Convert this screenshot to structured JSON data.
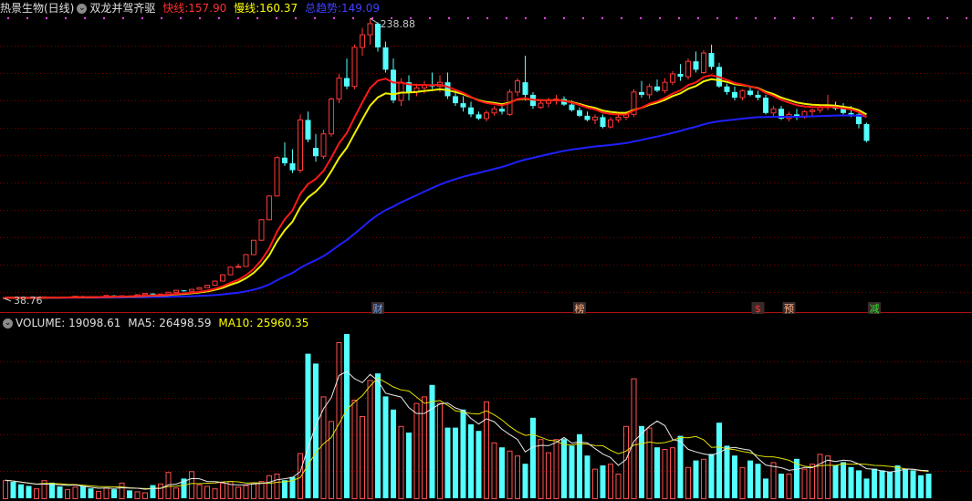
{
  "price_header": {
    "stock_name": "热景生物(日线)",
    "indicator_name": "双龙并驾齐驱",
    "fast_label": "快线:",
    "fast_value": "157.90",
    "fast_color": "#ff3030",
    "slow_label": "慢线:",
    "slow_value": "160.37",
    "slow_color": "#ffff00",
    "trend_label": "总趋势:",
    "trend_value": "149.09",
    "trend_color": "#3030ff"
  },
  "vol_header": {
    "vol_label": "VOLUME:",
    "vol_value": "19098.61",
    "ma5_label": "MA5:",
    "ma5_value": "26498.59",
    "ma10_label": "MA10:",
    "ma10_value": "25960.35"
  },
  "annotations": {
    "high_value": "238.88",
    "low_value": "38.76",
    "events": [
      {
        "text": "财",
        "color": "#6fa8ff"
      },
      {
        "text": "榜",
        "color": "#ffb080"
      },
      {
        "text": "$",
        "color": "#ff3030"
      },
      {
        "text": "预",
        "color": "#ffb080"
      },
      {
        "text": "减",
        "color": "#30e030"
      }
    ]
  },
  "chart_data": [
    {
      "type": "candlestick",
      "title": "热景生物(日线)",
      "series_names": [
        "快线",
        "慢线",
        "总趋势"
      ],
      "candles": [
        [
          38.5,
          39.2,
          38.0,
          38.6
        ],
        [
          38.6,
          38.9,
          38.3,
          38.5
        ],
        [
          38.5,
          38.8,
          38.1,
          38.4
        ],
        [
          38.4,
          38.7,
          38.0,
          38.3
        ],
        [
          38.3,
          39.0,
          38.1,
          38.8
        ],
        [
          38.8,
          39.5,
          38.6,
          39.2
        ],
        [
          39.2,
          39.3,
          38.7,
          38.9
        ],
        [
          38.9,
          39.1,
          38.5,
          38.7
        ],
        [
          38.7,
          39.4,
          38.6,
          39.1
        ],
        [
          39.1,
          39.8,
          38.9,
          39.6
        ],
        [
          39.6,
          39.9,
          39.2,
          39.4
        ],
        [
          39.4,
          39.6,
          38.9,
          39.0
        ],
        [
          39.0,
          39.5,
          38.8,
          39.3
        ],
        [
          39.3,
          40.4,
          39.1,
          40.2
        ],
        [
          40.2,
          40.5,
          39.6,
          39.8
        ],
        [
          39.8,
          40.2,
          39.4,
          40.0
        ],
        [
          40.0,
          40.3,
          39.5,
          39.7
        ],
        [
          39.7,
          40.9,
          39.5,
          40.7
        ],
        [
          40.7,
          41.9,
          40.5,
          41.6
        ],
        [
          41.6,
          41.8,
          40.8,
          41.0
        ],
        [
          41.0,
          41.3,
          40.6,
          41.2
        ],
        [
          41.2,
          42.8,
          41.0,
          42.5
        ],
        [
          42.5,
          44.2,
          42.3,
          43.9
        ],
        [
          43.9,
          44.0,
          42.9,
          43.2
        ],
        [
          43.2,
          44.8,
          43.0,
          44.6
        ],
        [
          44.6,
          46.1,
          44.4,
          45.8
        ],
        [
          45.8,
          47.8,
          45.6,
          47.5
        ],
        [
          47.5,
          50.9,
          47.3,
          50.5
        ],
        [
          50.5,
          55.5,
          50.3,
          55.0
        ],
        [
          55.0,
          61.0,
          54.8,
          60.5
        ],
        [
          60.5,
          63.0,
          60.1,
          61.0
        ],
        [
          61.0,
          70.0,
          60.8,
          69.5
        ],
        [
          69.5,
          80.0,
          69.0,
          79.8
        ],
        [
          79.8,
          95.0,
          79.5,
          94.5
        ],
        [
          94.5,
          112.0,
          94.0,
          111.5
        ],
        [
          111.5,
          140.0,
          111.0,
          139.0
        ],
        [
          139.0,
          150.0,
          133.0,
          135.0
        ],
        [
          135.0,
          145.0,
          128.0,
          130.0
        ],
        [
          130.0,
          170.0,
          128.0,
          166.0
        ],
        [
          166.0,
          172.0,
          150.0,
          152.0
        ],
        [
          146.0,
          156.0,
          136.0,
          140.0
        ],
        [
          140.0,
          159.0,
          138.0,
          156.0
        ],
        [
          156.0,
          182.0,
          154.0,
          181.0
        ],
        [
          181.0,
          199.0,
          178.0,
          196.0
        ],
        [
          196.0,
          210.0,
          188.0,
          190.0
        ],
        [
          190.0,
          220.0,
          188.0,
          218.0
        ],
        [
          218.0,
          232.0,
          212.0,
          227.0
        ],
        [
          227.0,
          238.88,
          220.0,
          235.0
        ],
        [
          235.0,
          236.0,
          215.0,
          218.0
        ],
        [
          218.0,
          222.0,
          200.0,
          202.0
        ],
        [
          202.0,
          210.0,
          178.0,
          180.0
        ],
        [
          180.0,
          196.0,
          176.0,
          193.0
        ],
        [
          193.0,
          198.0,
          180.0,
          186.0
        ],
        [
          186.0,
          192.0,
          183.0,
          189.0
        ],
        [
          189.0,
          194.0,
          185.0,
          191.0
        ],
        [
          191.0,
          200.0,
          188.0,
          190.0
        ],
        [
          190.0,
          198.0,
          186.0,
          193.0
        ],
        [
          193.0,
          200.0,
          181.0,
          183.0
        ],
        [
          183.0,
          188.0,
          176.0,
          178.0
        ],
        [
          178.0,
          183.0,
          172.0,
          175.0
        ],
        [
          175.0,
          179.0,
          168.0,
          170.0
        ],
        [
          170.0,
          172.0,
          166.0,
          167.0
        ],
        [
          167.0,
          173.0,
          165.0,
          171.0
        ],
        [
          171.0,
          176.0,
          169.0,
          174.0
        ],
        [
          174.0,
          178.0,
          170.0,
          172.0
        ],
        [
          170.0,
          188.0,
          169.0,
          186.0
        ],
        [
          186.0,
          196.0,
          183.0,
          194.0
        ],
        [
          193.0,
          212.0,
          180.0,
          184.0
        ],
        [
          184.0,
          186.0,
          174.0,
          176.0
        ],
        [
          175.0,
          181.0,
          174.0,
          178.0
        ],
        [
          178.0,
          182.0,
          175.0,
          180.0
        ],
        [
          180.0,
          184.0,
          177.0,
          181.0
        ],
        [
          181.0,
          183.0,
          176.0,
          177.0
        ],
        [
          177.0,
          180.0,
          172.0,
          173.0
        ],
        [
          173.0,
          175.0,
          168.0,
          169.0
        ],
        [
          169.0,
          172.0,
          165.0,
          166.0
        ],
        [
          166.0,
          170.0,
          163.0,
          168.0
        ],
        [
          168.0,
          170.0,
          160.0,
          161.0
        ],
        [
          161.0,
          168.0,
          160.0,
          166.0
        ],
        [
          166.0,
          170.0,
          164.0,
          168.0
        ],
        [
          168.0,
          172.0,
          166.0,
          170.0
        ],
        [
          170.0,
          188.0,
          168.0,
          186.0
        ],
        [
          186.0,
          194.0,
          182.0,
          184.0
        ],
        [
          184.0,
          192.0,
          181.0,
          190.0
        ],
        [
          190.0,
          195.0,
          186.0,
          187.0
        ],
        [
          187.0,
          196.0,
          185.0,
          193.0
        ],
        [
          193.0,
          201.0,
          191.0,
          199.0
        ],
        [
          199.0,
          206.0,
          194.0,
          197.0
        ],
        [
          197.0,
          210.0,
          195.0,
          208.0
        ],
        [
          208.0,
          215.0,
          200.0,
          202.0
        ],
        [
          200.0,
          216.0,
          199.0,
          214.0
        ],
        [
          214.0,
          220.0,
          202.0,
          204.0
        ],
        [
          204.0,
          207.0,
          189.0,
          190.0
        ],
        [
          190.0,
          192.0,
          184.0,
          186.0
        ],
        [
          186.0,
          190.0,
          180.0,
          182.0
        ],
        [
          182.0,
          188.0,
          180.0,
          187.0
        ],
        [
          187.0,
          190.0,
          183.0,
          184.0
        ],
        [
          184.0,
          187.0,
          180.0,
          182.0
        ],
        [
          182.0,
          184.0,
          170.0,
          171.0
        ],
        [
          171.0,
          176.0,
          168.0,
          174.0
        ],
        [
          174.0,
          176.0,
          166.0,
          167.0
        ],
        [
          167.0,
          172.0,
          165.0,
          170.0
        ],
        [
          170.0,
          174.0,
          166.0,
          168.0
        ],
        [
          168.0,
          173.0,
          167.0,
          172.0
        ],
        [
          172.0,
          174.0,
          169.0,
          173.0
        ],
        [
          173.0,
          177.0,
          171.0,
          175.0
        ],
        [
          175.0,
          184.0,
          173.0,
          176.0
        ],
        [
          176.0,
          179.0,
          173.0,
          174.0
        ],
        [
          174.0,
          178.0,
          170.0,
          171.0
        ],
        [
          171.0,
          176.0,
          168.0,
          170.0
        ],
        [
          170.0,
          172.0,
          160.0,
          163.0
        ],
        [
          163.0,
          164.0,
          150.0,
          151.0
        ]
      ],
      "ylim": [
        38.76,
        238.88
      ]
    },
    {
      "type": "bar",
      "title": "VOLUME",
      "series_names": [
        "VOLUME",
        "MA5",
        "MA10"
      ],
      "values": [
        11000,
        10000,
        8500,
        7500,
        6000,
        11000,
        9500,
        7200,
        5500,
        7000,
        7500,
        6000,
        4500,
        6500,
        5500,
        9500,
        4800,
        4200,
        3600,
        8000,
        9000,
        16000,
        6500,
        12000,
        16500,
        8500,
        7500,
        6000,
        9500,
        10500,
        7000,
        8000,
        9000,
        10500,
        14000,
        15000,
        11000,
        13000,
        27500,
        88000,
        82000,
        62000,
        47000,
        95000,
        100000,
        60000,
        50000,
        72000,
        76000,
        62000,
        54000,
        44000,
        40000,
        58000,
        62000,
        69000,
        58000,
        43000,
        43000,
        54000,
        45000,
        41000,
        59000,
        34000,
        31000,
        29000,
        26000,
        21000,
        49000,
        36000,
        28000,
        36000,
        36000,
        32000,
        39000,
        26000,
        18000,
        20000,
        21000,
        15000,
        44000,
        73000,
        44000,
        43000,
        31000,
        30000,
        31000,
        38000,
        19000,
        23000,
        24000,
        27000,
        46000,
        32000,
        26000,
        19000,
        23000,
        21000,
        12000,
        22000,
        15000,
        15000,
        24000,
        18000,
        21000,
        27000,
        26000,
        20000,
        22000,
        19000,
        17000,
        12000,
        18000,
        17000,
        16000,
        20000,
        18000,
        17000,
        14000,
        15000
      ]
    }
  ]
}
